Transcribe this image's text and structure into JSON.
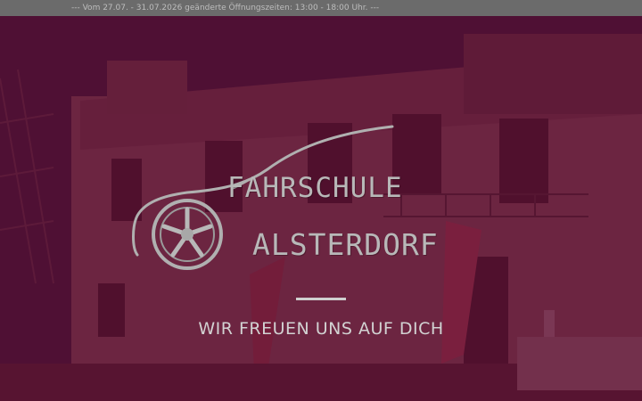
{
  "topbar": {
    "notice": "--- Vom 27.07. - 31.07.2026 geänderte Öffnungszeiten: 13:00 - 18:00 Uhr. ---"
  },
  "hero": {
    "overlay_color": "#600a30",
    "logo": {
      "line1": "FAHRSCHULE",
      "line2": "ALSTERDORF",
      "icon": "car-silhouette-with-wheel-icon"
    },
    "tagline": "WIR FREUEN UNS AUF DICH"
  }
}
